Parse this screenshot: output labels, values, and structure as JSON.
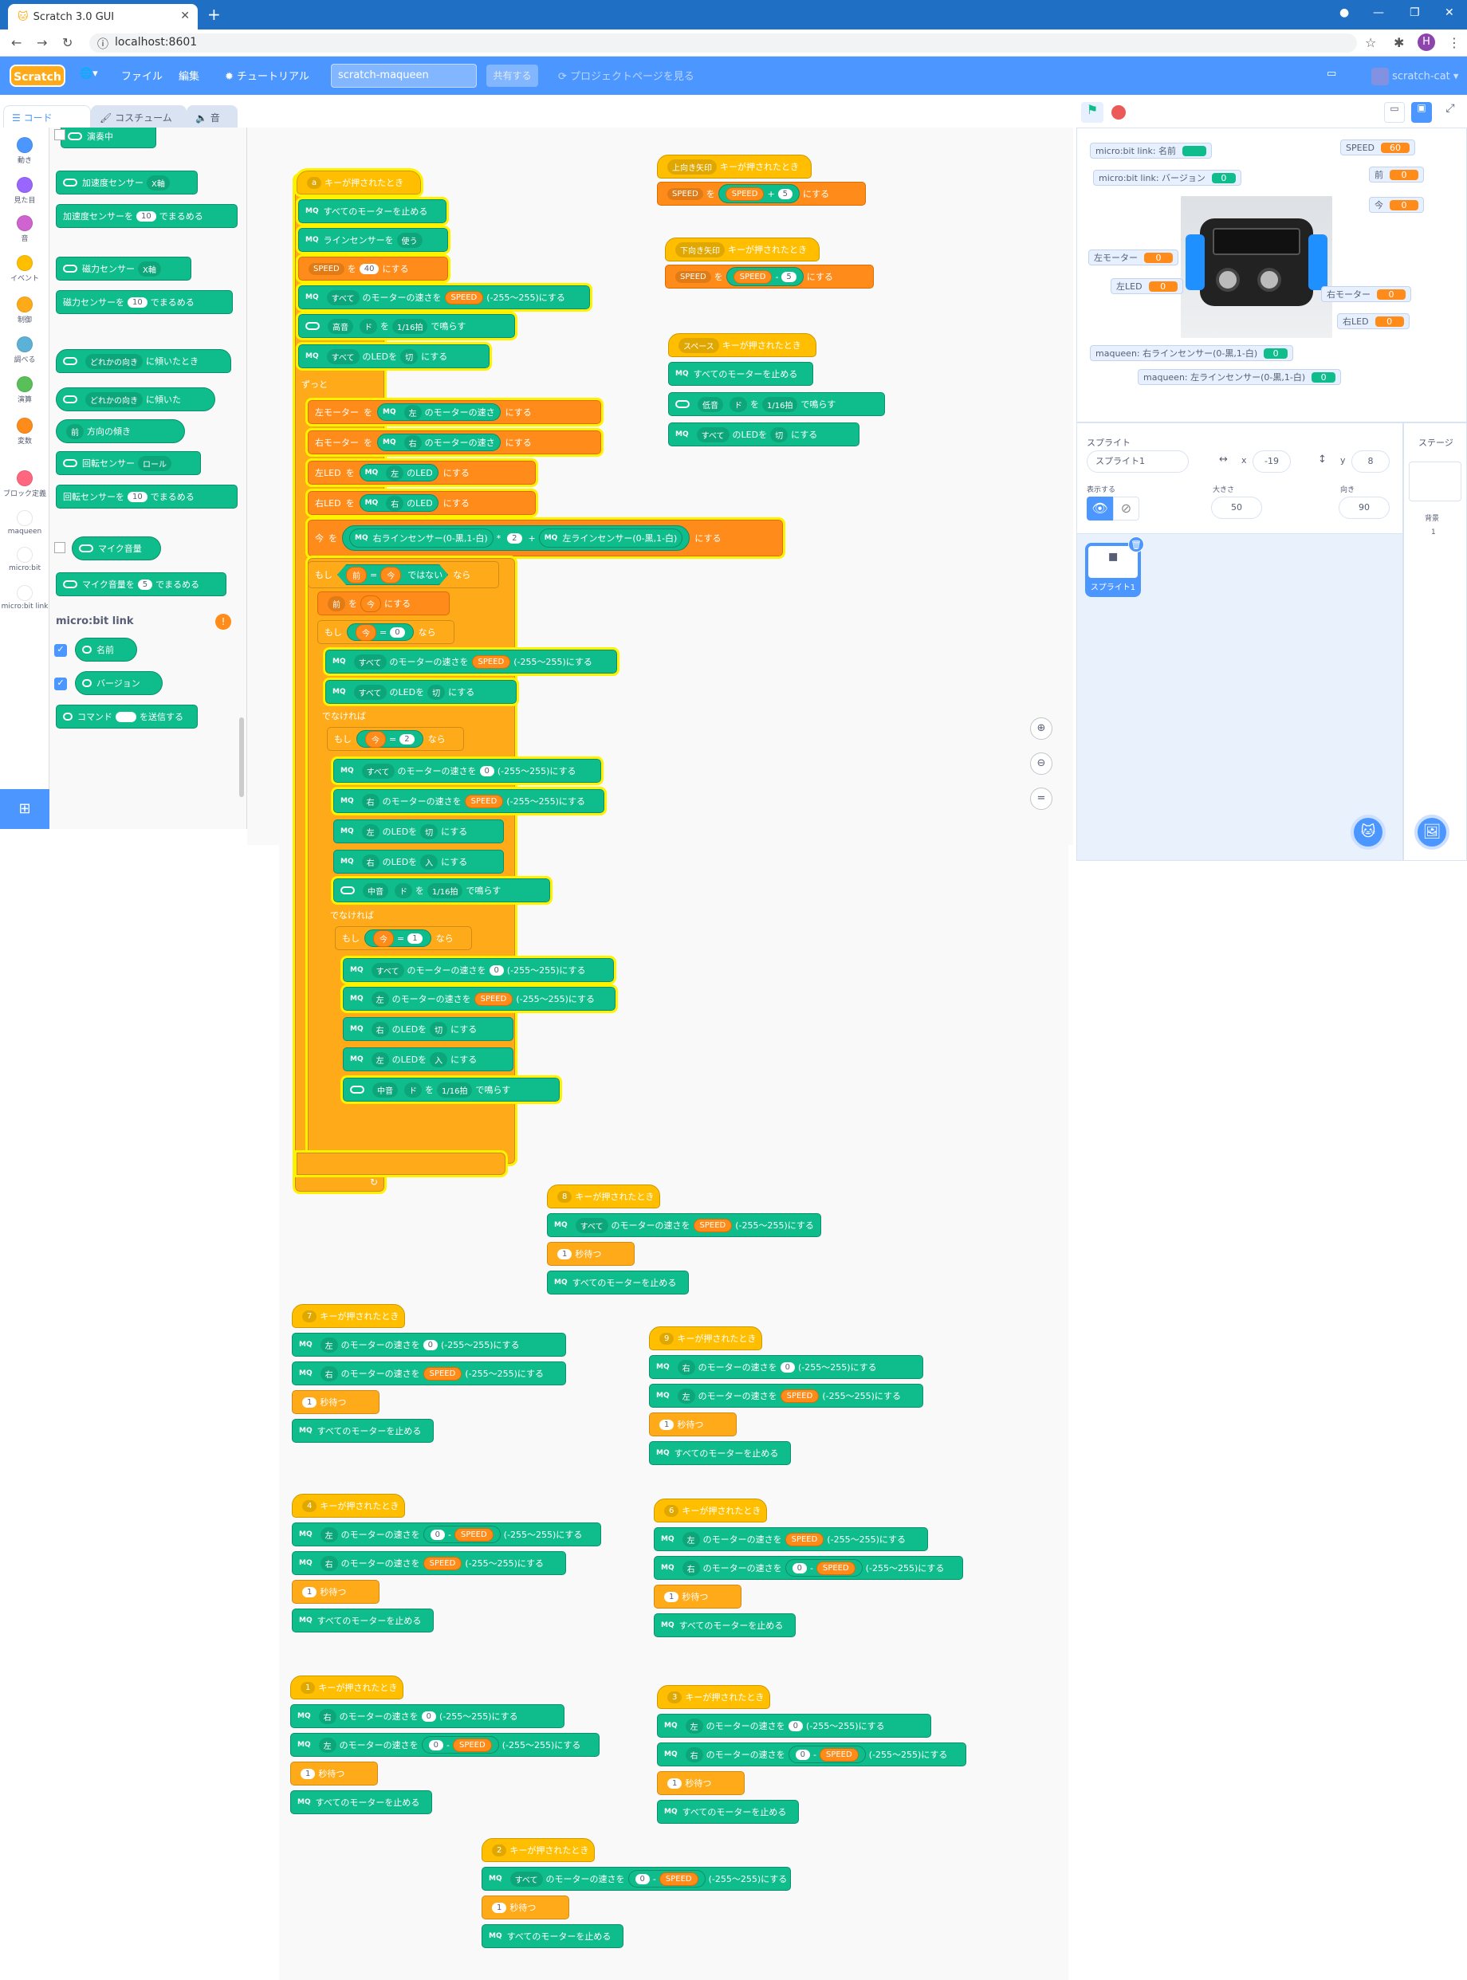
{
  "browser": {
    "tab_title": "Scratch 3.0 GUI",
    "url": "localhost:8601"
  },
  "menu": {
    "logo": "Scratch",
    "file": "ファイル",
    "edit": "編集",
    "tutorial": "チュートリアル",
    "project_name": "scratch-maqueen",
    "share": "共有する",
    "project_page": "プロジェクトページを見る",
    "user": "scratch-cat"
  },
  "editor_tabs": {
    "code": "コード",
    "costume": "コスチューム",
    "sound": "音"
  },
  "categories": [
    {
      "label": "動き",
      "color": "#4c97ff"
    },
    {
      "label": "見た目",
      "color": "#9966ff"
    },
    {
      "label": "音",
      "color": "#cf63cf"
    },
    {
      "label": "イベント",
      "color": "#ffbf00"
    },
    {
      "label": "制御",
      "color": "#ffab19"
    },
    {
      "label": "調べる",
      "color": "#5cb1d6"
    },
    {
      "label": "演算",
      "color": "#59c059"
    },
    {
      "label": "変数",
      "color": "#ff8c1a"
    },
    {
      "label": "ブロック定義",
      "color": "#ff6680"
    },
    {
      "label": "maqueen",
      "color": "#ffffff"
    },
    {
      "label": "micro:bit",
      "color": "#ffffff"
    },
    {
      "label": "micro:bit link",
      "color": "#ffffff"
    }
  ],
  "palette": {
    "b0": "演奏中",
    "b1a": "加速度センサー",
    "b1b": "X軸",
    "b2a": "加速度センサーを",
    "b2b": "10",
    "b2c": "でまるめる",
    "b3a": "磁力センサー",
    "b3b": "X軸",
    "b4a": "磁力センサーを",
    "b4b": "10",
    "b4c": "でまるめる",
    "b5a": "どれかの向き",
    "b5b": "に傾いたとき",
    "b6a": "どれかの向き",
    "b6b": "に傾いた",
    "b7a": "前",
    "b7b": "方向の傾き",
    "b8a": "回転センサー",
    "b8b": "ロール",
    "b9a": "回転センサーを",
    "b9b": "10",
    "b9c": "でまるめる",
    "b10": "マイク音量",
    "b11a": "マイク音量を",
    "b11b": "5",
    "b11c": "でまるめる",
    "section": "micro:bit link",
    "b12": "名前",
    "b13": "バージョン",
    "b14a": "コマンド",
    "b14b": "を送信する"
  },
  "main_script": {
    "hat_key": "a",
    "hat_text": "キーが押されたとき",
    "s1": "すべてのモーターを止める",
    "s2a": "ラインセンサーを",
    "s2b": "使う",
    "s3a": "SPEED",
    "s3b": "を",
    "s3c": "40",
    "s3d": "にする",
    "s4a": "すべて",
    "s4b": "のモーターの速さを",
    "s4c": "SPEED",
    "s4d": "(-255〜255)にする",
    "s5a": "高音",
    "s5b": "ド",
    "s5c": "を",
    "s5d": "1/16拍",
    "s5e": "で鳴らす",
    "s6a": "すべて",
    "s6b": "のLEDを",
    "s6c": "切",
    "s6d": "にする",
    "forever": "ずっと",
    "f1a": "左モーター",
    "f1b": "を",
    "f1c": "左",
    "f1d": "のモーターの速さ",
    "f1e": "にする",
    "f2a": "右モーター",
    "f2b": "を",
    "f2c": "右",
    "f2d": "のモーターの速さ",
    "f2e": "にする",
    "f3a": "左LED",
    "f3b": "を",
    "f3c": "左",
    "f3d": "のLED",
    "f3e": "にする",
    "f4a": "右LED",
    "f4b": "を",
    "f4c": "右",
    "f4d": "のLED",
    "f4e": "にする",
    "f5a": "今",
    "f5b": "を",
    "f5c": "右ラインセンサー(0-黒,1-白)",
    "f5d": "*",
    "f5e": "2",
    "f5f": "+",
    "f5g": "左ラインセンサー(0-黒,1-白)",
    "f5h": "にする",
    "if1a": "もし",
    "if1b": "前",
    "if1c": "=",
    "if1d": "今",
    "if1e": "ではない",
    "if1f": "なら",
    "i1": "前",
    "i1b": "を",
    "i1c": "今",
    "i1d": "にする",
    "if2a": "もし",
    "if2b": "今",
    "if2c": "=",
    "if2d": "0",
    "if2e": "なら",
    "i2a": "すべて",
    "i2b": "のモーターの速さを",
    "i2c": "SPEED",
    "i2d": "(-255〜255)にする",
    "i3a": "すべて",
    "i3b": "のLEDを",
    "i3c": "切",
    "i3d": "にする",
    "else": "でなければ",
    "if3a": "もし",
    "if3b": "今",
    "if3c": "=",
    "if3d": "2",
    "if3e": "なら",
    "j1a": "すべて",
    "j1b": "のモーターの速さを",
    "j1c": "0",
    "j1d": "(-255〜255)にする",
    "j2a": "右",
    "j2b": "のモーターの速さを",
    "j2c": "SPEED",
    "j2d": "(-255〜255)にする",
    "j3a": "左",
    "j3b": "のLEDを",
    "j3c": "切",
    "j3d": "にする",
    "j4a": "右",
    "j4b": "のLEDを",
    "j4c": "入",
    "j4d": "にする",
    "j5a": "中音",
    "j5b": "ド",
    "j5c": "を",
    "j5d": "1/16拍",
    "j5e": "で鳴らす",
    "else2": "でなければ",
    "if4a": "もし",
    "if4b": "今",
    "if4c": "=",
    "if4d": "1",
    "if4e": "なら",
    "k1a": "すべて",
    "k1b": "のモーターの速さを",
    "k1c": "0",
    "k1d": "(-255〜255)にする",
    "k2a": "左",
    "k2b": "のモーターの速さを",
    "k2c": "SPEED",
    "k2d": "(-255〜255)にする",
    "k3a": "右",
    "k3b": "のLEDを",
    "k3c": "切",
    "k3d": "にする",
    "k4a": "左",
    "k4b": "のLEDを",
    "k4c": "入",
    "k4d": "にする",
    "k5a": "中音",
    "k5b": "ド",
    "k5c": "を",
    "k5d": "1/16拍",
    "k5e": "で鳴らす"
  },
  "up_script": {
    "key": "上向き矢印",
    "hat": "キーが押されたとき",
    "a": "SPEED",
    "b": "を",
    "c": "SPEED",
    "d": "+",
    "e": "5",
    "f": "にする"
  },
  "down_script": {
    "key": "下向き矢印",
    "hat": "キーが押されたとき",
    "a": "SPEED",
    "b": "を",
    "c": "SPEED",
    "d": "-",
    "e": "5",
    "f": "にする"
  },
  "space_script": {
    "key": "スペース",
    "hat": "キーが押されたとき",
    "s1": "すべてのモーターを止める",
    "s2a": "低音",
    "s2b": "ド",
    "s2c": "を",
    "s2d": "1/16拍",
    "s2e": "で鳴らす",
    "s3a": "すべて",
    "s3b": "のLEDを",
    "s3c": "切",
    "s3d": "にする"
  },
  "key_scripts": [
    {
      "key": "8",
      "hat": "キーが押されたとき",
      "l1a": "すべて",
      "l1b": "のモーターの速さを",
      "l1c": "SPEED",
      "l1d": "(-255〜255)にする",
      "wait": "1",
      "waitl": "秒待つ",
      "stop": "すべてのモーターを止める"
    },
    {
      "key": "7",
      "hat": "キーが押されたとき",
      "l1a": "左",
      "l1b": "のモーターの速さを",
      "l1c": "0",
      "l1d": "(-255〜255)にする",
      "l2a": "右",
      "l2b": "のモーターの速さを",
      "l2c": "SPEED",
      "l2d": "(-255〜255)にする",
      "wait": "1",
      "waitl": "秒待つ",
      "stop": "すべてのモーターを止める"
    },
    {
      "key": "9",
      "hat": "キーが押されたとき",
      "l1a": "右",
      "l1b": "のモーターの速さを",
      "l1c": "0",
      "l1d": "(-255〜255)にする",
      "l2a": "左",
      "l2b": "のモーターの速さを",
      "l2c": "SPEED",
      "l2d": "(-255〜255)にする",
      "wait": "1",
      "waitl": "秒待つ",
      "stop": "すべてのモーターを止める"
    },
    {
      "key": "4",
      "hat": "キーが押されたとき",
      "l1a": "左",
      "l1b": "のモーターの速さを",
      "l1c": "0",
      "l1m": "-",
      "l1n": "SPEED",
      "l1d": "(-255〜255)にする",
      "l2a": "右",
      "l2b": "のモーターの速さを",
      "l2c": "SPEED",
      "l2d": "(-255〜255)にする",
      "wait": "1",
      "waitl": "秒待つ",
      "stop": "すべてのモーターを止める"
    },
    {
      "key": "6",
      "hat": "キーが押されたとき",
      "l1a": "左",
      "l1b": "のモーターの速さを",
      "l1c": "SPEED",
      "l1d": "(-255〜255)にする",
      "l2a": "右",
      "l2b": "のモーターの速さを",
      "l2c": "0",
      "l2m": "-",
      "l2n": "SPEED",
      "l2d": "(-255〜255)にする",
      "wait": "1",
      "waitl": "秒待つ",
      "stop": "すべてのモーターを止める"
    },
    {
      "key": "1",
      "hat": "キーが押されたとき",
      "l1a": "右",
      "l1b": "のモーターの速さを",
      "l1c": "0",
      "l1d": "(-255〜255)にする",
      "l2a": "左",
      "l2b": "のモーターの速さを",
      "l2c": "0",
      "l2m": "-",
      "l2n": "SPEED",
      "l2d": "(-255〜255)にする",
      "wait": "1",
      "waitl": "秒待つ",
      "stop": "すべてのモーターを止める"
    },
    {
      "key": "3",
      "hat": "キーが押されたとき",
      "l1a": "左",
      "l1b": "のモーターの速さを",
      "l1c": "0",
      "l1d": "(-255〜255)にする",
      "l2a": "右",
      "l2b": "のモーターの速さを",
      "l2c": "0",
      "l2m": "-",
      "l2n": "SPEED",
      "l2d": "(-255〜255)にする",
      "wait": "1",
      "waitl": "秒待つ",
      "stop": "すべてのモーターを止める"
    },
    {
      "key": "2",
      "hat": "キーが押されたとき",
      "l1a": "すべて",
      "l1b": "のモーターの速さを",
      "l1c": "0",
      "l1m": "-",
      "l1n": "SPEED",
      "l1d": "(-255〜255)にする",
      "wait": "1",
      "waitl": "秒待つ",
      "stop": "すべてのモーターを止める"
    }
  ],
  "monitors": {
    "name_label": "micro:bit link: 名前",
    "version_label": "micro:bit link: バージョン",
    "version_val": "0",
    "speed_label": "SPEED",
    "speed_val": "60",
    "front_label": "前",
    "front_val": "0",
    "now_label": "今",
    "now_val": "0",
    "lm_label": "左モーター",
    "lm_val": "0",
    "rm_label": "右モーター",
    "rm_val": "0",
    "lled_label": "左LED",
    "lled_val": "0",
    "rled_label": "右LED",
    "rled_val": "0",
    "rline_label": "maqueen: 右ラインセンサー(0-黒,1-白)",
    "rline_val": "0",
    "lline_label": "maqueen: 左ラインセンサー(0-黒,1-白)",
    "lline_val": "0"
  },
  "sprite_info": {
    "sprite_label": "スプライト",
    "sprite_name": "スプライト1",
    "x_label": "x",
    "x_val": "-19",
    "y_label": "y",
    "y_val": "8",
    "show_label": "表示する",
    "size_label": "大きさ",
    "size_val": "50",
    "dir_label": "向き",
    "dir_val": "90",
    "thumb_name": "スプライト1"
  },
  "stage_info": {
    "label": "ステージ",
    "backdrop_label": "背景",
    "backdrop_count": "1"
  }
}
